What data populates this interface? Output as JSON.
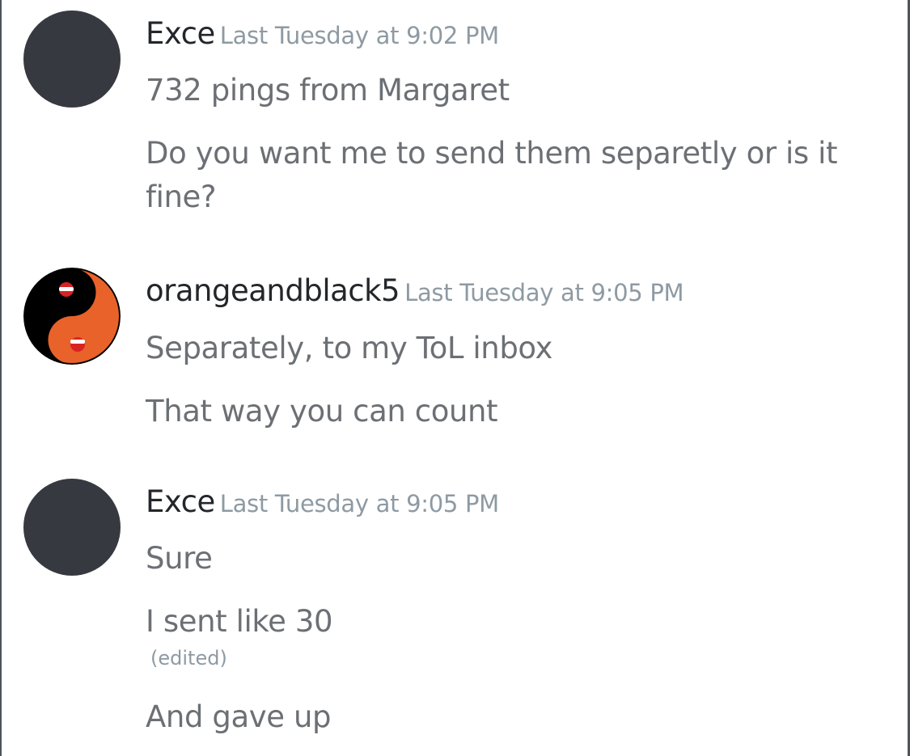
{
  "messages": [
    {
      "username": "Exce",
      "timestamp": "Last Tuesday at 9:02 PM",
      "avatar": "default-dark-avatar",
      "lines": [
        "732 pings from Margaret",
        "Do you want me to send them separetly or is it fine?"
      ]
    },
    {
      "username": "orangeandblack5",
      "timestamp": "Last Tuesday at 9:05 PM",
      "avatar": "orange-black-yin-yang-avatar",
      "lines": [
        "Separately, to my ToL inbox",
        "That way you can count"
      ]
    },
    {
      "username": "Exce",
      "timestamp": "Last Tuesday at 9:05 PM",
      "avatar": "default-dark-avatar",
      "lines": [
        "Sure",
        "I sent like 30",
        "And gave up"
      ],
      "edited_label": "(edited)"
    }
  ],
  "colors": {
    "username": "#23262a",
    "timestamp": "#8e9aa3",
    "message_text": "#6c7075",
    "avatar_default": "#36393f",
    "yin_yang_orange": "#e8622a",
    "yin_yang_black": "#000000"
  }
}
